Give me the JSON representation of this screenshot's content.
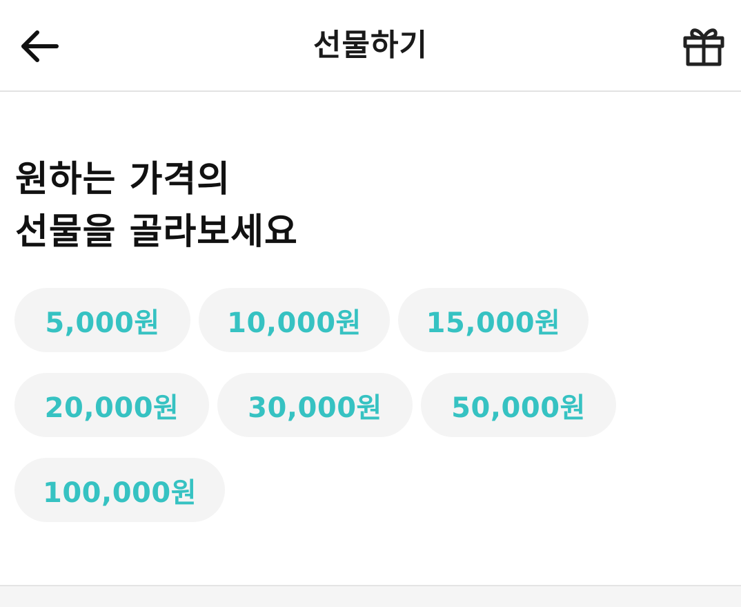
{
  "header": {
    "title": "선물하기",
    "back_icon": "arrow-left-icon",
    "gift_icon": "gift-icon"
  },
  "headline": {
    "line1": "원하는 가격의",
    "line2": "선물을 골라보세요"
  },
  "price_options": [
    {
      "label": "5,000원"
    },
    {
      "label": "10,000원"
    },
    {
      "label": "15,000원"
    },
    {
      "label": "20,000원"
    },
    {
      "label": "30,000원"
    },
    {
      "label": "50,000원"
    },
    {
      "label": "100,000원"
    }
  ],
  "colors": {
    "accent": "#36c2c2",
    "chip_background": "#f4f4f4",
    "divider": "#e2e2e2"
  }
}
